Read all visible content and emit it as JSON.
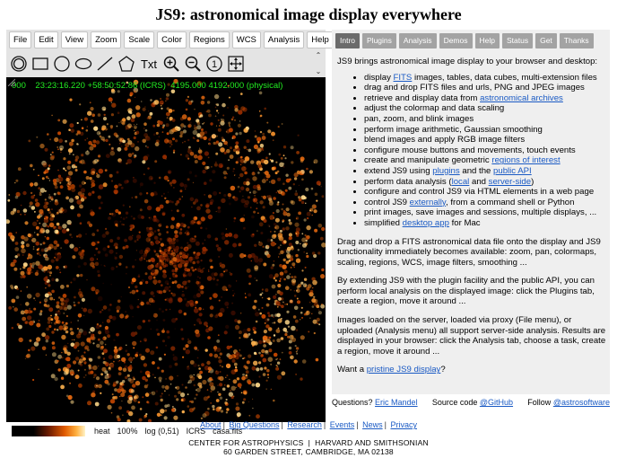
{
  "title": "JS9: astronomical image display everywhere",
  "menubar": [
    "File",
    "Edit",
    "View",
    "Zoom",
    "Scale",
    "Color",
    "Regions",
    "WCS",
    "Analysis",
    "Help"
  ],
  "toolbar": {
    "icons": [
      "circle-region-icon",
      "box-region-icon",
      "ellipse-circle-icon",
      "ellipse-region-icon",
      "line-region-icon",
      "polygon-region-icon",
      "text-region-icon",
      "zoom-in-icon",
      "zoom-out-icon",
      "zoom-one-icon",
      "pan-center-icon"
    ],
    "text_tool": "Txt",
    "zoom_one_label": "1"
  },
  "infobox": {
    "index": "000",
    "coords": "23:23:16.220 +58:50:52.86 (ICRS)",
    "physical": "4195.000 4192.000 (physical)"
  },
  "colorbar": {
    "colormap": "heat",
    "zoom": "100%",
    "scale": "log (0,51)",
    "wcs": "ICRS",
    "file": "casa.fits"
  },
  "tabs": [
    "Intro",
    "Plugins",
    "Analysis",
    "Demos",
    "Help",
    "Status",
    "Get",
    "Thanks"
  ],
  "intro": {
    "lead": "JS9 brings astronomical image display to your browser and desktop:",
    "features": [
      {
        "pre": "display ",
        "link": "FITS",
        "post": " images, tables, data cubes, multi-extension files"
      },
      {
        "pre": "drag and drop FITS files and urls, PNG and JPEG images"
      },
      {
        "pre": "retrieve and display data from ",
        "link": "astronomical archives",
        "post": ""
      },
      {
        "pre": "adjust the colormap and data scaling"
      },
      {
        "pre": "pan, zoom, and blink images"
      },
      {
        "pre": "perform image arithmetic, Gaussian smoothing"
      },
      {
        "pre": "blend images and apply RGB image filters"
      },
      {
        "pre": "configure mouse buttons and movements, touch events"
      },
      {
        "pre": "create and manipulate geometric ",
        "link": "regions of interest",
        "post": ""
      },
      {
        "pre": "extend JS9 using ",
        "link": "plugins",
        "mid": " and the ",
        "link2": "public API",
        "post": ""
      },
      {
        "pre": "perform data analysis (",
        "link": "local",
        "mid": " and ",
        "link2": "server-side",
        "post": ")"
      },
      {
        "pre": "configure and control JS9 via HTML elements in a web page"
      },
      {
        "pre": "control JS9 ",
        "link": "externally",
        "post": ", from a command shell or Python"
      },
      {
        "pre": "print images, save images and sessions, multiple displays, ..."
      },
      {
        "pre": "simplified ",
        "link": "desktop app",
        "post": " for Mac"
      }
    ],
    "para1": "Drag and drop a FITS astronomical data file onto the display and JS9 functionality immediately becomes available: zoom, pan, colormaps, scaling, regions, WCS, image filters, smoothing ...",
    "para2": "By extending JS9 with the plugin facility and the public API, you can perform local analysis on the displayed image: click the Plugins tab, create a region, move it around ...",
    "para3": "Images loaded on the server, loaded via proxy (File menu), or uploaded (Analysis menu) all support server-side analysis. Results are displayed in your browser: click the Analysis tab, choose a task, create a region, move it around ...",
    "want_pre": "Want a ",
    "want_link": "pristine JS9 display",
    "want_post": "?"
  },
  "footer": {
    "questions_label": "Questions?",
    "questions_link": "Eric Mandel",
    "source_label": "Source code",
    "source_link": "@GitHub",
    "follow_label": "Follow",
    "follow_link": "@astrosoftware"
  },
  "bottom_links": [
    "About",
    "Big Questions",
    "Research",
    "Events",
    "News",
    "Privacy"
  ],
  "org": "CENTER FOR ASTROPHYSICS  |  HARVARD AND SMITHSONIAN",
  "address": "60 GARDEN STREET, CAMBRIDGE, MA 02138",
  "colors": {
    "infobox_text": "#22ee22",
    "link": "#1a5ac4",
    "tab_active": "#6b6b6b",
    "tab_inactive": "#a3a3a3",
    "panel_bg": "#efefef",
    "display_bg": "#000000"
  }
}
